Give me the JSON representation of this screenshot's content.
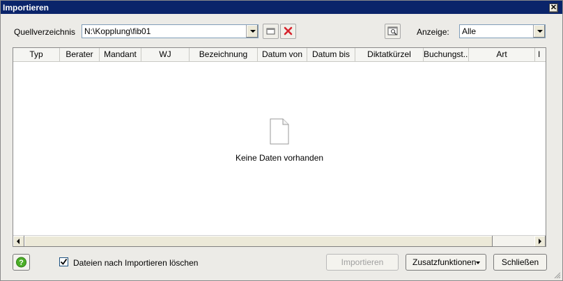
{
  "window": {
    "title": "Importieren",
    "close_label": "✕"
  },
  "source": {
    "label": "Quellverzeichnis",
    "path": "N:\\Kopplung\\fib01"
  },
  "display": {
    "label": "Anzeige:",
    "value": "Alle"
  },
  "grid": {
    "columns": [
      "Typ",
      "Berater",
      "Mandant",
      "WJ",
      "Bezeichnung",
      "Datum von",
      "Datum bis",
      "Diktatkürzel",
      "Buchungst...",
      "Art",
      "I"
    ],
    "empty_text": "Keine Daten vorhanden"
  },
  "footer": {
    "delete_after_import_label": "Dateien nach Importieren löschen",
    "delete_after_import_checked": true,
    "import_label": "Importieren",
    "extra_label": "Zusatzfunktionen",
    "close_label": "Schließen"
  },
  "colors": {
    "titlebar": "#0a246a",
    "background": "#ecebe7",
    "delete_icon": "#d6232d",
    "help_icon": "#4caf27"
  }
}
